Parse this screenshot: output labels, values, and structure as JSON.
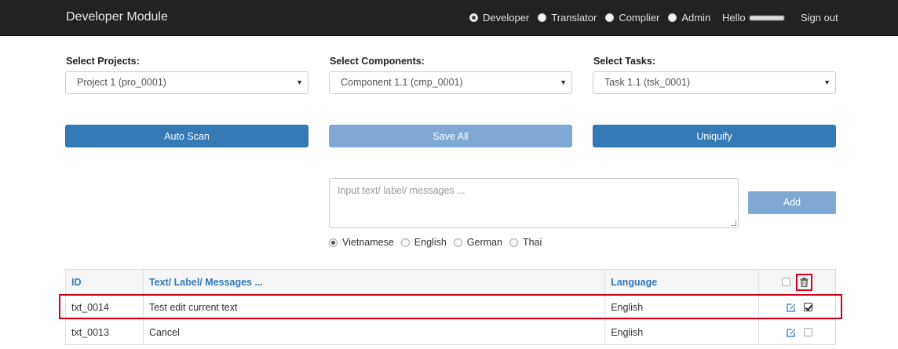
{
  "navbar": {
    "brand": "Developer Module",
    "roles": [
      {
        "label": "Developer",
        "selected": true
      },
      {
        "label": "Translator",
        "selected": false
      },
      {
        "label": "Complier",
        "selected": false
      },
      {
        "label": "Admin",
        "selected": false
      }
    ],
    "hello": "Hello",
    "sign_out": "Sign out"
  },
  "filters": {
    "projects": {
      "label": "Select Projects:",
      "value": "Project 1 (pro_0001)"
    },
    "components": {
      "label": "Select Components:",
      "value": "Component 1.1 (cmp_0001)"
    },
    "tasks": {
      "label": "Select Tasks:",
      "value": "Task 1.1 (tsk_0001)"
    }
  },
  "actions": {
    "auto_scan": "Auto Scan",
    "save_all": "Save All",
    "uniquify": "Uniquify",
    "add": "Add"
  },
  "input": {
    "placeholder": "Input text/ label/ messages ..."
  },
  "languages": [
    {
      "label": "Vietnamese",
      "selected": true
    },
    {
      "label": "English",
      "selected": false
    },
    {
      "label": "German",
      "selected": false
    },
    {
      "label": "Thai",
      "selected": false
    }
  ],
  "table": {
    "headers": {
      "id": "ID",
      "text": "Text/ Label/ Messages ...",
      "language": "Language"
    },
    "rows": [
      {
        "id": "txt_0014",
        "text": "Test edit current text",
        "language": "English",
        "checked": true
      },
      {
        "id": "txt_0013",
        "text": "Cancel",
        "language": "English",
        "checked": false
      }
    ]
  },
  "colors": {
    "navbar": "#222222",
    "primary": "#337ab7",
    "disabled": "#7fa8d4",
    "highlight": "#d0021b"
  },
  "icons": {
    "edit": "edit-icon",
    "trash": "trash-icon"
  }
}
